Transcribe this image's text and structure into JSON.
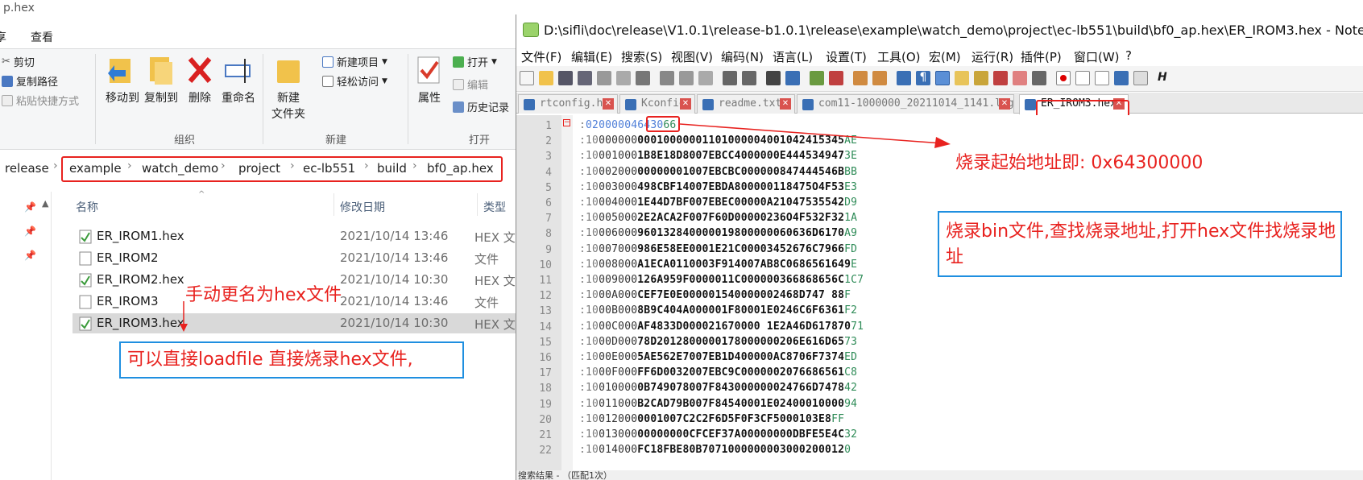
{
  "explorer": {
    "title_fragment": "p.hex",
    "window_controls": [
      "—",
      "☐",
      "✕"
    ],
    "tabs": [
      "享",
      "查看"
    ],
    "ribbon": {
      "clipboard": {
        "cut": "剪切",
        "copy_path": "复制路径",
        "paste_shortcut": "粘贴快捷方式"
      },
      "organize": {
        "move_to": "移动到",
        "copy_to": "复制到",
        "delete": "删除",
        "rename": "重命名",
        "label": "组织"
      },
      "new": {
        "new_folder": "新建\n文件夹",
        "new_item": "新建项目",
        "easy_access": "轻松访问",
        "label": "新建"
      },
      "open": {
        "properties": "属性",
        "open": "打开",
        "edit": "编辑",
        "history": "历史记录",
        "label": "打开"
      }
    },
    "breadcrumb": [
      "release",
      "example",
      "watch_demo",
      "project",
      "ec-lb551",
      "build",
      "bf0_ap.hex"
    ],
    "columns": {
      "name": "名称",
      "date": "修改日期",
      "type": "类型"
    },
    "files": [
      {
        "name": "ER_IROM1.hex",
        "date": "2021/10/14 13:46",
        "type": "HEX 文",
        "kind": "hex"
      },
      {
        "name": "ER_IROM2",
        "date": "2021/10/14 13:46",
        "type": "文件",
        "kind": "file"
      },
      {
        "name": "ER_IROM2.hex",
        "date": "2021/10/14 10:30",
        "type": "HEX 文",
        "kind": "hex"
      },
      {
        "name": "ER_IROM3",
        "date": "2021/10/14 13:46",
        "type": "文件",
        "kind": "file"
      },
      {
        "name": "ER_IROM3.hex",
        "date": "2021/10/14 10:30",
        "type": "HEX 文",
        "kind": "hex",
        "selected": true
      }
    ]
  },
  "npp": {
    "title": "D:\\sifli\\doc\\release\\V1.0.1\\release-b1.0.1\\release\\example\\watch_demo\\project\\ec-lb551\\build\\bf0_ap.hex\\ER_IROM3.hex - Notepad++",
    "menu": [
      "文件(F)",
      "编辑(E)",
      "搜索(S)",
      "视图(V)",
      "编码(N)",
      "语言(L)",
      "设置(T)",
      "工具(O)",
      "宏(M)",
      "运行(R)",
      "插件(P)",
      "窗口(W)",
      "?"
    ],
    "tabs": [
      "rtconfig.h",
      "Kconfig",
      "readme.txt",
      "com11-1000000_20211014_1141.log",
      "ER_IROM3.hex"
    ],
    "lines": [
      [
        ":",
        "02",
        "0000",
        "04",
        "6430",
        "66"
      ],
      [
        ":",
        "10",
        "0000",
        "00",
        "00010000001101000004001042415345",
        "AE"
      ],
      [
        ":",
        "10",
        "0010",
        "00",
        "1B8E18D8007EBCC4000000E444534947",
        "3E"
      ],
      [
        ":",
        "10",
        "0020",
        "00",
        "00000001007EBCBC000000847444546B",
        "BB"
      ],
      [
        ":",
        "10",
        "0030",
        "00",
        "498CBF14007EBDA800000118475O4F53",
        "E3"
      ],
      [
        ":",
        "10",
        "0040",
        "00",
        "1E44D7BF007EBEC00000A21047535542",
        "D9"
      ],
      [
        ":",
        "10",
        "0050",
        "00",
        "2E2ACA2F007F60D00000236O4F532F32",
        "1A"
      ],
      [
        ":",
        "10",
        "0060",
        "00",
        "960132840000019800000060636D6170",
        "A9"
      ],
      [
        ":",
        "10",
        "0070",
        "00",
        "986E58EE0001E21C00003452676C7966",
        "FD"
      ],
      [
        ":",
        "10",
        "0080",
        "00",
        "A1ECA0110003F914007AB8C0686561649",
        "E"
      ],
      [
        ":",
        "10",
        "0090",
        "00",
        "126A959F0000011C000000366868656C",
        "1C7"
      ],
      [
        ":",
        "10",
        "00A0",
        "00",
        "CEF7E0E000001540000002468D747 88",
        "F"
      ],
      [
        ":",
        "10",
        "00B0",
        "00",
        "8B9C404A000001F80001E0246C6F6361",
        "F2"
      ],
      [
        ":",
        "10",
        "00C0",
        "00",
        "AF4833D000021670000 1E2A46D617870",
        "71"
      ],
      [
        ":",
        "10",
        "00D0",
        "00",
        "78D2012800000178000000206E616D65",
        "73"
      ],
      [
        ":",
        "10",
        "00E0",
        "00",
        "5AE562E7007EB1D400000AC8706F7374",
        "ED"
      ],
      [
        ":",
        "10",
        "00F0",
        "00",
        "FF6D0032007EBC9C0000002076686561",
        "C8"
      ],
      [
        ":",
        "10",
        "0100",
        "00",
        "0B749078007F843000000024766D7478",
        "42"
      ],
      [
        ":",
        "10",
        "0110",
        "00",
        "B2CAD79B007F84540001E02400010000",
        "94"
      ],
      [
        ":",
        "10",
        "0120",
        "00",
        "0001007C2C2F6D5F0F3CF5000103E8",
        "FF"
      ],
      [
        ":",
        "10",
        "0130",
        "00",
        "00000000CFCEF37A00000000DBFE5E4C",
        "32"
      ],
      [
        ":",
        "10",
        "0140",
        "00",
        "FC18FBE80B7071000000003000200012",
        "0"
      ]
    ],
    "status": "搜索结果 - （匹配1次）"
  },
  "annotations": {
    "burn_address": "烧录起始地址即: 0x64300000",
    "find_address": "烧录bin文件,查找烧录地址,打开hex文件找烧录地址",
    "rename": "手动更名为hex文件",
    "loadfile": "可以直接loadfile 直接烧录hex文件,"
  }
}
